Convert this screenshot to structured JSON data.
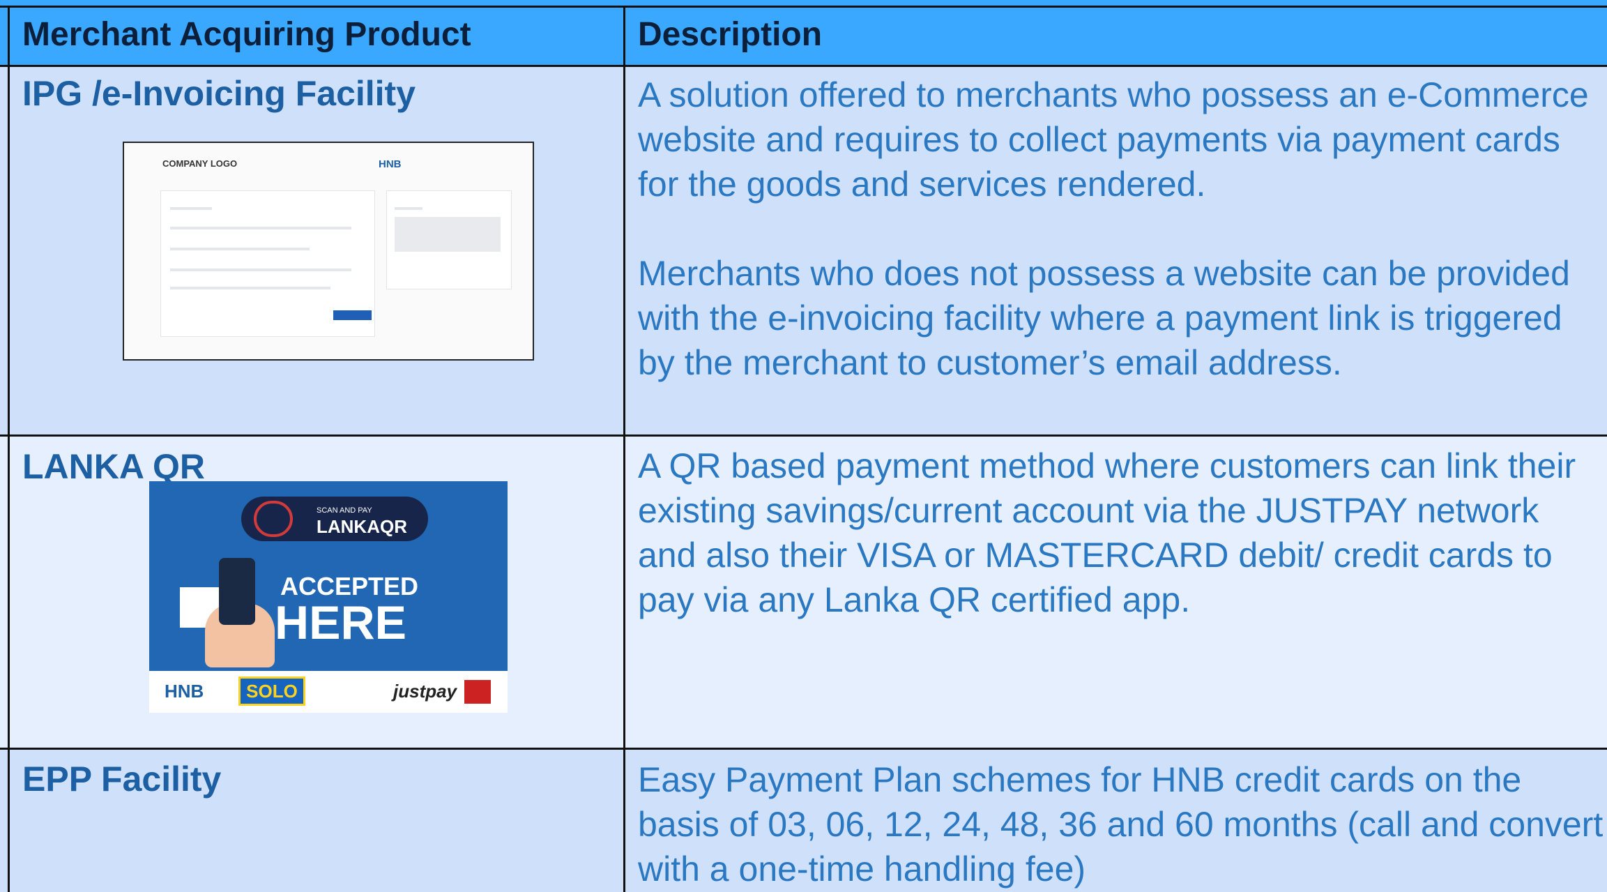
{
  "header": {
    "col1": "Merchant Acquiring Product",
    "col2": "Description"
  },
  "rows": [
    {
      "product": "IPG /e-Invoicing Facility",
      "description_p1": "A solution offered to  merchants who possess an e-Commerce website and requires to collect payments via payment cards for the goods and services rendered.",
      "description_p2": "Merchants who does not possess a website can be provided with the e-invoicing facility where a payment link is triggered by the merchant to customer’s email address.",
      "image": {
        "company_logo": "COMPANY LOGO",
        "bank_logo": "HNB"
      }
    },
    {
      "product": "LANKA QR",
      "description_p1": "A QR based payment method where customers can link their existing savings/current account via the JUSTPAY network and also their VISA or MASTERCARD debit/ credit cards to pay via any Lanka QR certified app.",
      "image": {
        "scan_and_pay": "SCAN AND PAY",
        "lanka_qr": "LANKAQR",
        "accepted": "ACCEPTED",
        "here": "HERE",
        "footer_hnb": "HNB",
        "footer_solo": "SOLO",
        "footer_justpay": "justpay"
      }
    },
    {
      "product": "EPP Facility",
      "description_p1": "Easy Payment Plan schemes for HNB credit cards on the basis of 03, 06, 12, 24, 48, 36 and 60 months (call and convert with a one-time handling fee)"
    }
  ],
  "colors": {
    "header_bg": "#3aa8ff",
    "row_bg_a": "#cfe0fb",
    "row_bg_b": "#e6effd",
    "title_color": "#1c5fa3",
    "desc_color": "#2a78c2"
  }
}
